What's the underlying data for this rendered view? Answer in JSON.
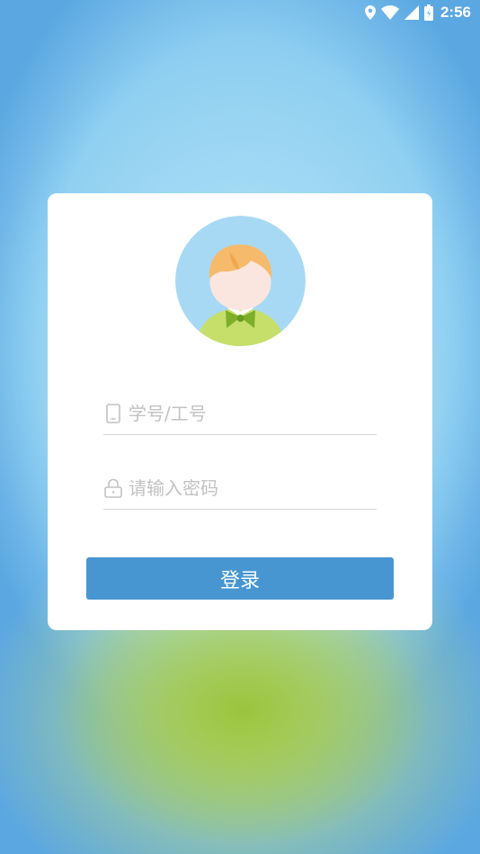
{
  "status_bar": {
    "time": "2:56",
    "icons": [
      "location-icon",
      "wifi-icon",
      "signal-icon",
      "battery-icon"
    ]
  },
  "login": {
    "account": {
      "value": "",
      "placeholder": "学号/工号",
      "icon": "phone-icon"
    },
    "password": {
      "value": "",
      "placeholder": "请输入密码",
      "icon": "lock-icon"
    },
    "submit_label": "登录"
  },
  "colors": {
    "button": "#4796d1",
    "card": "#ffffff",
    "avatar_bg": "#a8d9f4",
    "avatar_hair": "#f6ba6c",
    "avatar_shirt": "#c5df6a",
    "avatar_bow": "#7fae2a"
  }
}
